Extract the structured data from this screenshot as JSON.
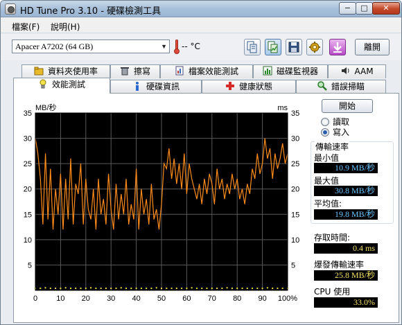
{
  "window": {
    "title": "HD Tune Pro 3.10 - 硬碟檢測工具",
    "minimize_glyph": "−",
    "maximize_glyph": "□",
    "close_glyph": "✕"
  },
  "menu": [
    {
      "label": "檔案(F)"
    },
    {
      "label": "說明(H)"
    }
  ],
  "toolbar": {
    "drive": "Apacer A7202 (64 GB)",
    "temperature": "-- °C",
    "icons": [
      "copy-icon",
      "copy-active-icon",
      "save-icon",
      "options-icon",
      "download-icon"
    ],
    "exit_label": "離開"
  },
  "tabs_row1": [
    {
      "label": "資料夾使用率",
      "icon": "folder-icon"
    },
    {
      "label": "擦寫",
      "icon": "trash-icon"
    },
    {
      "label": "檔案效能測試",
      "icon": "file-test-icon"
    },
    {
      "label": "磁碟監視器",
      "icon": "monitor-icon"
    },
    {
      "label": "AAM",
      "icon": "speaker-icon"
    }
  ],
  "tabs_row2": [
    {
      "label": "效能測試",
      "icon": "bulb-icon",
      "active": true
    },
    {
      "label": "硬碟資訊",
      "icon": "info-icon"
    },
    {
      "label": "健康狀態",
      "icon": "health-cross-icon"
    },
    {
      "label": "錯誤掃瞄",
      "icon": "magnifier-icon"
    }
  ],
  "controls": {
    "start_label": "開始",
    "read_label": "讀取",
    "write_label": "寫入",
    "selected_mode": "write"
  },
  "transfer": {
    "group_title": "傳輸速率",
    "min_label": "最小值",
    "min_value": "10.9 MB/秒",
    "max_label": "最大值",
    "max_value": "30.8 MB/秒",
    "avg_label": "平均值:",
    "avg_value": "19.8 MB/秒"
  },
  "access_time": {
    "label": "存取時間:",
    "value": "0.4 ms"
  },
  "burst_rate": {
    "label": "爆發傳輸速率",
    "value": "25.8 MB/秒"
  },
  "cpu_usage": {
    "label": "CPU 使用",
    "value": "33.0%"
  },
  "colors": {
    "line": "#ff8c1a",
    "access_dots": "#f0e040",
    "chart_bg": "#000000",
    "grid": "#5a5a5a",
    "value_text_yellow": "#f4e26a",
    "value_text_blue": "#6cc7ff"
  },
  "chart_data": {
    "type": "line",
    "ylabel_left": "MB/秒",
    "ylabel_right": "ms",
    "yticks": [
      "35",
      "30",
      "25",
      "20",
      "15",
      "10",
      "5"
    ],
    "xticks": [
      "0",
      "10",
      "20",
      "30",
      "40",
      "50",
      "60",
      "70",
      "80",
      "90",
      "100%"
    ],
    "ylim": [
      0,
      35
    ],
    "xlim": [
      0,
      100
    ],
    "grid": true,
    "series": [
      {
        "x": [
          0,
          1,
          2,
          3,
          4,
          5,
          6,
          7,
          8,
          9,
          10,
          11,
          12,
          13,
          14,
          15,
          16,
          17,
          18,
          19,
          20,
          21,
          22,
          23,
          24,
          25,
          26,
          27,
          28,
          29,
          30,
          31,
          32,
          33,
          34,
          35,
          36,
          37,
          38,
          39,
          40,
          41,
          42,
          43,
          44,
          45,
          46,
          47,
          48,
          49,
          50,
          51,
          52,
          53,
          54,
          55,
          56,
          57,
          58,
          59,
          60,
          61,
          62,
          63,
          64,
          65,
          66,
          67,
          68,
          69,
          70,
          71,
          72,
          73,
          74,
          75,
          76,
          77,
          78,
          79,
          80,
          81,
          82,
          83,
          84,
          85,
          86,
          87,
          88,
          89,
          90,
          91,
          92,
          93,
          94,
          95,
          96,
          97,
          98,
          99,
          100
        ],
        "values": [
          30,
          27,
          22,
          13,
          27,
          14,
          24,
          12,
          20,
          15,
          23,
          12,
          22,
          14,
          26,
          13,
          21,
          19,
          25,
          13,
          22,
          16,
          14,
          20,
          12,
          22,
          15,
          18,
          13,
          23,
          16,
          12,
          21,
          14,
          19,
          15,
          22,
          13,
          17,
          14,
          24,
          12,
          20,
          15,
          18,
          13,
          21,
          14,
          16,
          12,
          17,
          25,
          24,
          28,
          22,
          26,
          21,
          25,
          20,
          27,
          19,
          25,
          22,
          20,
          18,
          21,
          17,
          22,
          19,
          23,
          21,
          17,
          24,
          20,
          22,
          18,
          21,
          19,
          23,
          20,
          22,
          18,
          20,
          17,
          21,
          19,
          24,
          22,
          27,
          23,
          25,
          30,
          26,
          28,
          22,
          27,
          24,
          26,
          29,
          25,
          27
        ]
      },
      {
        "x": [
          0,
          2,
          4,
          6,
          8,
          10,
          12,
          14,
          16,
          18,
          20,
          22,
          24,
          26,
          28,
          30,
          32,
          34,
          36,
          38,
          40,
          42,
          44,
          46,
          48,
          50,
          52,
          54,
          56,
          58,
          60,
          62,
          64,
          66,
          68,
          70,
          72,
          74,
          76,
          78,
          80,
          82,
          84,
          86,
          88,
          90,
          92,
          94,
          96,
          98,
          100
        ],
        "values": [
          0.4,
          0.4,
          0.5,
          0.4,
          0.4,
          0.4,
          0.5,
          0.4,
          0.4,
          0.4,
          0.4,
          0.5,
          0.4,
          0.4,
          0.4,
          0.4,
          0.4,
          0.5,
          0.4,
          0.4,
          0.4,
          0.4,
          0.4,
          0.4,
          0.5,
          0.4,
          0.4,
          0.4,
          0.4,
          0.4,
          0.4,
          0.5,
          0.4,
          0.4,
          0.4,
          0.4,
          0.4,
          0.4,
          0.5,
          0.4,
          0.4,
          0.4,
          0.4,
          0.4,
          0.4,
          0.4,
          0.5,
          0.4,
          0.4,
          0.4,
          0.4
        ]
      }
    ]
  }
}
